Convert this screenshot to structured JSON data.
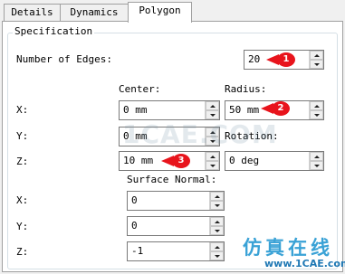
{
  "tabs": [
    {
      "label": "Details",
      "active": false
    },
    {
      "label": "Dynamics",
      "active": false
    },
    {
      "label": "Polygon",
      "active": true
    }
  ],
  "group_title": "Specification",
  "edges": {
    "label": "Number of Edges:",
    "value": "20"
  },
  "center": {
    "header": "Center:",
    "x": {
      "label": "X:",
      "value": "0 mm"
    },
    "y": {
      "label": "Y:",
      "value": "0 mm"
    },
    "z": {
      "label": "Z:",
      "value": "10 mm"
    }
  },
  "radius": {
    "header": "Radius:",
    "value": "50 mm"
  },
  "rotation": {
    "header": "Rotation:",
    "value": "0 deg"
  },
  "normal": {
    "header": "Surface Normal:",
    "x": {
      "label": "X:",
      "value": "0"
    },
    "y": {
      "label": "Y:",
      "value": "0"
    },
    "z": {
      "label": "Z:",
      "value": "-1"
    }
  },
  "markers": [
    "1",
    "2",
    "3"
  ],
  "watermark": "1CAE.COM",
  "brand": {
    "chinese": "仿真在线",
    "url": "www.1CAE.com"
  },
  "colors": {
    "marker_red": "#e8141c",
    "brand_blue": "#3aa2d6"
  }
}
